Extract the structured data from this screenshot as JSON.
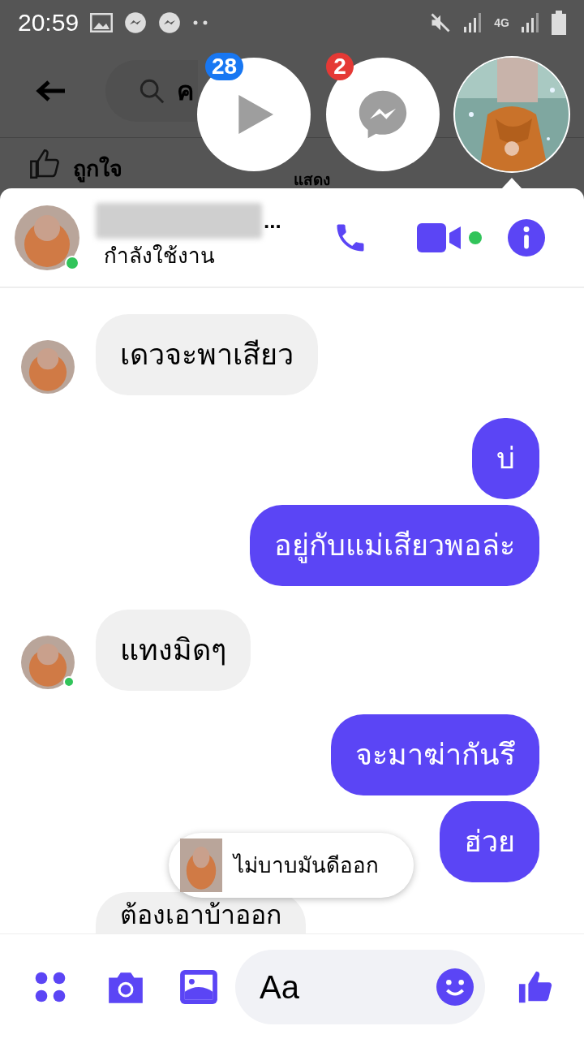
{
  "status_bar": {
    "time": "20:59",
    "network": "4G"
  },
  "background_page": {
    "search_text": "ค",
    "actions": [
      {
        "kind": "like",
        "label": "ถูกใจ"
      },
      {
        "kind": "comment",
        "label": "แสดง"
      }
    ]
  },
  "chat_heads": [
    {
      "kind": "video",
      "badge": "28",
      "selected": false
    },
    {
      "kind": "messenger",
      "badge": "2",
      "selected": false
    },
    {
      "kind": "avatar",
      "selected": true
    }
  ],
  "conversation": {
    "name_tail": "...",
    "status": "กำลังใช้งาน",
    "online": true,
    "video_available": true
  },
  "messages": [
    {
      "kind": "received",
      "text": "เดวจะพาเสียว",
      "avatar": true,
      "online": false
    },
    {
      "kind": "sent",
      "text": "บ่"
    },
    {
      "kind": "sent",
      "text": "อยู่กับแม่เสียวพอล่ะ"
    },
    {
      "kind": "received",
      "text": "แทงมิดๆ",
      "avatar": true,
      "online": true
    },
    {
      "kind": "sent",
      "text": "จะมาฆ่ากันรึ"
    },
    {
      "kind": "sent",
      "text": "ฮ่วย"
    },
    {
      "kind": "received",
      "text": "ต้องเอาบ้าออก",
      "avatar": false,
      "online": false
    }
  ],
  "preview": {
    "text": "ไม่บาบมันดีออก"
  },
  "composer": {
    "placeholder": "Aa"
  }
}
